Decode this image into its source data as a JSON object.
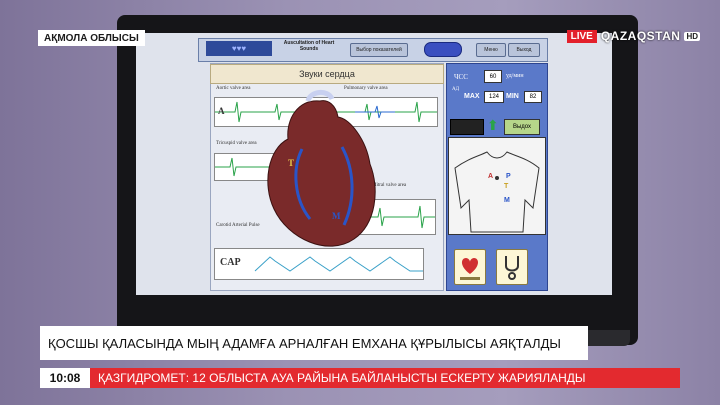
{
  "overlay": {
    "region_tag": "АҚМОЛА ОБЛЫСЫ",
    "live_label": "LIVE",
    "channel_name": "QAZAQSTAN",
    "hd_label": "HD",
    "headline": "ҚОСШЫ ҚАЛАСЫНДА МЫҢ АДАМҒА АРНАЛҒАН ЕМХАНА ҚҰРЫЛЫСЫ АЯҚТАЛДЫ",
    "time": "10:08",
    "ticker_text": "ҚАЗГИДРОМЕТ: 12 ОБЛЫСТА АУА РАЙЫНА БАЙЛАНЫСТЫ ЕСКЕРТУ ЖАРИЯЛАНДЫ",
    "colors": {
      "live_red": "#e3202b",
      "ticker_red": "#e32a2f"
    }
  },
  "app": {
    "title": "Auscultation of Heart Sounds",
    "select_indicator_label": "Выбор показателей",
    "menu_label": "Меню",
    "exit_label": "Выход",
    "panel_title": "Звуки сердца",
    "aortic_label": "Aortic valve area",
    "pulmonary_label": "Pulmonary valve area",
    "tricuspid_label": "Tricuspid valve area",
    "mitral_label": "Mitral valve area",
    "carotid_label": "Carotid Arterial Pulse",
    "cap_label": "CAP",
    "marker_a": "A",
    "marker_p": "P",
    "marker_t": "T",
    "marker_m": "M",
    "hr_label": "ЧСС",
    "hr_value": "60",
    "hr_unit": "уд/мин",
    "bp_label": "АД",
    "max_label": "MAX",
    "max_value": "124",
    "min_label": "MIN",
    "min_value": "82",
    "output_label": "Выдох",
    "body_markers": [
      "A",
      "P",
      "T",
      "M"
    ]
  }
}
